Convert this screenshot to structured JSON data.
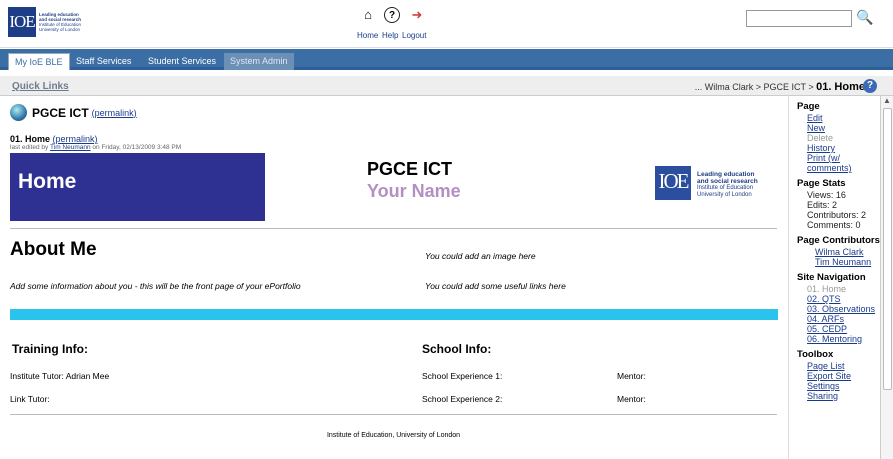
{
  "topbar": {
    "logo_text": "IOE",
    "logo_lines": [
      "Leading education",
      "and social research",
      "Institute of Education",
      "University of London"
    ],
    "icons": [
      {
        "name": "home-icon",
        "label": "Home"
      },
      {
        "name": "help-icon",
        "label": "Help"
      },
      {
        "name": "logout-icon",
        "label": "Logout"
      }
    ],
    "search_value": ""
  },
  "tabs": [
    "My IoE BLE",
    "Staff Services",
    "Student Services",
    "System Admin"
  ],
  "quicklinks": "Quick Links",
  "breadcrumb": {
    "prefix": "... Wilma Clark > PGCE ICT > ",
    "current": "01. Home"
  },
  "page": {
    "site_title": "PGCE ICT",
    "permalink": "(permalink)",
    "page_name": "01. Home",
    "edited_prefix": "last edited by",
    "edited_user": "Tim Neumann",
    "edited_suffix": "on Friday, 02/13/2009 3:48 PM",
    "banner_text": "Home",
    "title": "PGCE ICT",
    "your_name": "Your Name",
    "about": "About Me",
    "image_note": "You could add an image here",
    "info_note": "Add some information about you - this will be the front page of your ePortfolio",
    "links_note": "You could add some useful links here",
    "training": "Training Info:",
    "school": "School Info:",
    "inst_tutor": "Institute Tutor: Adrian Mee",
    "link_tutor": "Link Tutor:",
    "sch_exp1": "School Experience 1:",
    "sch_exp2": "School Experience 2:",
    "mentor": "Mentor:",
    "footer": "Institute of Education, University of London"
  },
  "sidebar": {
    "page_h": "Page",
    "page_links": [
      "Edit",
      "New",
      "Delete",
      "History",
      "Print (w/",
      "comments)"
    ],
    "stats_h": "Page Stats",
    "stats": [
      "Views: 16",
      "Edits: 2",
      "Contributors: 2",
      "Comments: 0"
    ],
    "contrib_h": "Page Contributors",
    "contributors": [
      "Wilma Clark",
      "Tim Neumann"
    ],
    "nav_h": "Site Navigation",
    "nav": [
      "01. Home",
      "02. QTS",
      "03. Observations",
      "04. ARFs",
      "05. CEDP",
      "06. Mentoring"
    ],
    "toolbox_h": "Toolbox",
    "toolbox": [
      "Page List",
      "Export Site",
      "Settings",
      "Sharing"
    ]
  }
}
